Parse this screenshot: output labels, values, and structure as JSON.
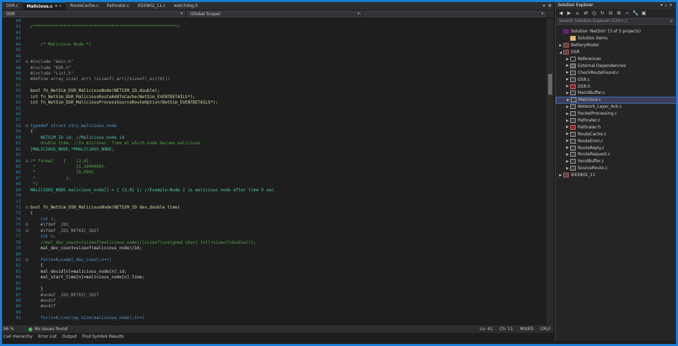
{
  "tabs": [
    {
      "label": "DSR.c",
      "active": false
    },
    {
      "label": "Malicious.c",
      "active": true
    },
    {
      "label": "RouteCache.c",
      "active": false
    },
    {
      "label": "Pathrater.c",
      "active": false
    },
    {
      "label": "IEEE802_11.c",
      "active": false
    },
    {
      "label": "watchdog.h",
      "active": false
    }
  ],
  "nav": {
    "project": "DSR",
    "scope": "(Global Scope)"
  },
  "code_lines": [
    {
      "n": "40",
      "t": "",
      "c": "c-def"
    },
    {
      "n": "41",
      "t": "/*********************************************************/",
      "c": "c-com"
    },
    {
      "n": "42",
      "t": "",
      "c": "c-def"
    },
    {
      "n": "43",
      "t": "",
      "c": "c-def"
    },
    {
      "n": "44",
      "t": "    /* Malicious Node */",
      "c": "c-com"
    },
    {
      "n": "45",
      "t": "",
      "c": "c-def"
    },
    {
      "n": "46",
      "t": "",
      "c": "c-def"
    },
    {
      "n": "47",
      "t": "#include \"main.h\"",
      "c": "c-pp"
    },
    {
      "n": "48",
      "t": "#include \"DSR.h\"",
      "c": "c-pp"
    },
    {
      "n": "49",
      "t": "#include \"List.h\"",
      "c": "c-pp"
    },
    {
      "n": "50",
      "t": "#define array_size(_arr) (sizeof(_arr)/sizeof(_arr[0]))",
      "c": "c-pp"
    },
    {
      "n": "51",
      "t": "",
      "c": "c-def"
    },
    {
      "n": "52",
      "t": "bool fn_NetSim_DSR_MaliciousNode(NETSIM_ID,double);",
      "c": "c-fn"
    },
    {
      "n": "53",
      "t": "int fn_NetSim_DSR_MaliciousRouteAddToCache(NetSim_EVENTDETAILS*);",
      "c": "c-fn"
    },
    {
      "n": "54",
      "t": "int fn_NetSim_DSR_MaliciousProcessSourceRouteOption(NetSim_EVENTDETAILS*);",
      "c": "c-fn"
    },
    {
      "n": "55",
      "t": "",
      "c": "c-def"
    },
    {
      "n": "56",
      "t": "",
      "c": "c-def"
    },
    {
      "n": "57",
      "t": "",
      "c": "c-def"
    },
    {
      "n": "58",
      "t": "typedef struct stru_malicious_node",
      "c": "c-kw"
    },
    {
      "n": "59",
      "t": "{",
      "c": "c-def"
    },
    {
      "n": "60",
      "t": "    NETSIM_ID id; //Malicious node id",
      "c": "c-typ"
    },
    {
      "n": "61",
      "t": "    double time; //In microsec. Time at which node become malicious",
      "c": "c-com"
    },
    {
      "n": "62",
      "t": "}MALICIOUS_NODE,*PMALICIOUS_NODE;",
      "c": "c-typ"
    },
    {
      "n": "63",
      "t": "",
      "c": "c-def"
    },
    {
      "n": "64",
      "t": "/* format    {    {2,0},",
      "c": "c-com"
    },
    {
      "n": "65",
      "t": " *                {5,1000000},",
      "c": "c-com"
    },
    {
      "n": "66",
      "t": " *                {8,000}",
      "c": "c-com"
    },
    {
      "n": "67",
      "t": " *            };",
      "c": "c-com"
    },
    {
      "n": "68",
      "t": " */",
      "c": "c-com"
    },
    {
      "n": "69",
      "t": "MALICIOUS_NODE malicious_node[] = { {3,0} }; //Example:Node 2 is malicious node after time 0 sec.",
      "c": "c-typ"
    },
    {
      "n": "70",
      "t": "",
      "c": "c-def"
    },
    {
      "n": "71",
      "t": "",
      "c": "c-def"
    },
    {
      "n": "72",
      "t": "bool fn_NetSim_DSR_MaliciousNode(NETSIM_ID dev,double time)",
      "c": "c-fn"
    },
    {
      "n": "73",
      "t": "{",
      "c": "c-def"
    },
    {
      "n": "74",
      "t": "    int i;",
      "c": "c-kw"
    },
    {
      "n": "75",
      "t": "    #ifdef _IDS_",
      "c": "c-pp"
    },
    {
      "n": "76",
      "t": "    #ifdef _IDS_METRIC_INIT",
      "c": "c-pp"
    },
    {
      "n": "77",
      "t": "    int n;",
      "c": "c-kw"
    },
    {
      "n": "78",
      "t": "    //mal_dev_count=(sizeof(malicious_node)/(sizeof(unsigned short int)+sizeof(double)));",
      "c": "c-com"
    },
    {
      "n": "79",
      "t": "    mal_dev_count=sizeof(malicious_node)/16;",
      "c": "c-def"
    },
    {
      "n": "80",
      "t": "",
      "c": "c-def"
    },
    {
      "n": "81",
      "t": "    for(n=0;n<mal_dev_count;n++)",
      "c": "c-kw"
    },
    {
      "n": "82",
      "t": "    {",
      "c": "c-def"
    },
    {
      "n": "83",
      "t": "    mal_devid[n]=malicious_node[n].id;",
      "c": "c-def"
    },
    {
      "n": "84",
      "t": "    mal_start_time[n]=malicious_node[n].time;",
      "c": "c-def"
    },
    {
      "n": "85",
      "t": "",
      "c": "c-def"
    },
    {
      "n": "86",
      "t": "    }",
      "c": "c-def"
    },
    {
      "n": "87",
      "t": "    #undef _IDS_METRIC_INIT",
      "c": "c-pp"
    },
    {
      "n": "88",
      "t": "    #endif",
      "c": "c-pp"
    },
    {
      "n": "89",
      "t": "    #endif",
      "c": "c-pp"
    },
    {
      "n": "90",
      "t": "",
      "c": "c-def"
    },
    {
      "n": "91",
      "t": "    for(i=0;i<array_size(malicious_node);i++)",
      "c": "c-kw"
    }
  ],
  "status": {
    "zoom": "96 %",
    "issues": "No issues found",
    "ln": "Ln: 41",
    "ch": "Ch: 11",
    "mode": "MIXED",
    "eol": "CRLF"
  },
  "bottom_tabs": [
    "Call Hierarchy",
    "Error List",
    "Output",
    "Find Symbol Results"
  ],
  "solution_explorer": {
    "title": "Solution Explorer",
    "search_placeholder": "Search Solution Explorer (Ctrl+;)",
    "items": [
      {
        "label": "Solution 'NetSim' (3 of 3 projects)",
        "depth": 0,
        "icon": "i-sln",
        "arrow": ""
      },
      {
        "label": "Solution Items",
        "depth": 1,
        "icon": "i-folder",
        "arrow": ""
      },
      {
        "label": "BatteryModel",
        "depth": 0,
        "icon": "i-proj",
        "arrow": "▶"
      },
      {
        "label": "DSR",
        "depth": 0,
        "icon": "i-proj",
        "arrow": "◢"
      },
      {
        "label": "References",
        "depth": 1,
        "icon": "i-ref",
        "arrow": "▶"
      },
      {
        "label": "External Dependencies",
        "depth": 1,
        "icon": "i-ext",
        "arrow": "▶"
      },
      {
        "label": "CheckRouteFound.c",
        "depth": 1,
        "icon": "i-c",
        "arrow": "▶"
      },
      {
        "label": "DSR.c",
        "depth": 1,
        "icon": "i-c",
        "arrow": "▶"
      },
      {
        "label": "DSR.h",
        "depth": 1,
        "icon": "i-h",
        "arrow": "▶"
      },
      {
        "label": "MaintBuffer.c",
        "depth": 1,
        "icon": "i-c",
        "arrow": "▶"
      },
      {
        "label": "Malicious.c",
        "depth": 1,
        "icon": "i-c",
        "arrow": "▶",
        "selected": true
      },
      {
        "label": "Network_Layer_Ack.c",
        "depth": 1,
        "icon": "i-c",
        "arrow": "▶"
      },
      {
        "label": "PacketProcessing.c",
        "depth": 1,
        "icon": "i-c",
        "arrow": "▶"
      },
      {
        "label": "Pathrater.c",
        "depth": 1,
        "icon": "i-c",
        "arrow": "▶"
      },
      {
        "label": "Pathrater.h",
        "depth": 1,
        "icon": "i-h",
        "arrow": "▶"
      },
      {
        "label": "RouteCache.c",
        "depth": 1,
        "icon": "i-c",
        "arrow": "▶"
      },
      {
        "label": "RouteError.c",
        "depth": 1,
        "icon": "i-c",
        "arrow": "▶"
      },
      {
        "label": "RouteReply.c",
        "depth": 1,
        "icon": "i-c",
        "arrow": "▶"
      },
      {
        "label": "RouteRequest.c",
        "depth": 1,
        "icon": "i-c",
        "arrow": "▶"
      },
      {
        "label": "SendBuffer.c",
        "depth": 1,
        "icon": "i-c",
        "arrow": "▶"
      },
      {
        "label": "SourceRoute.c",
        "depth": 1,
        "icon": "i-c",
        "arrow": "▶"
      },
      {
        "label": "IEEE802_11",
        "depth": 0,
        "icon": "i-proj",
        "arrow": "▶"
      }
    ]
  }
}
